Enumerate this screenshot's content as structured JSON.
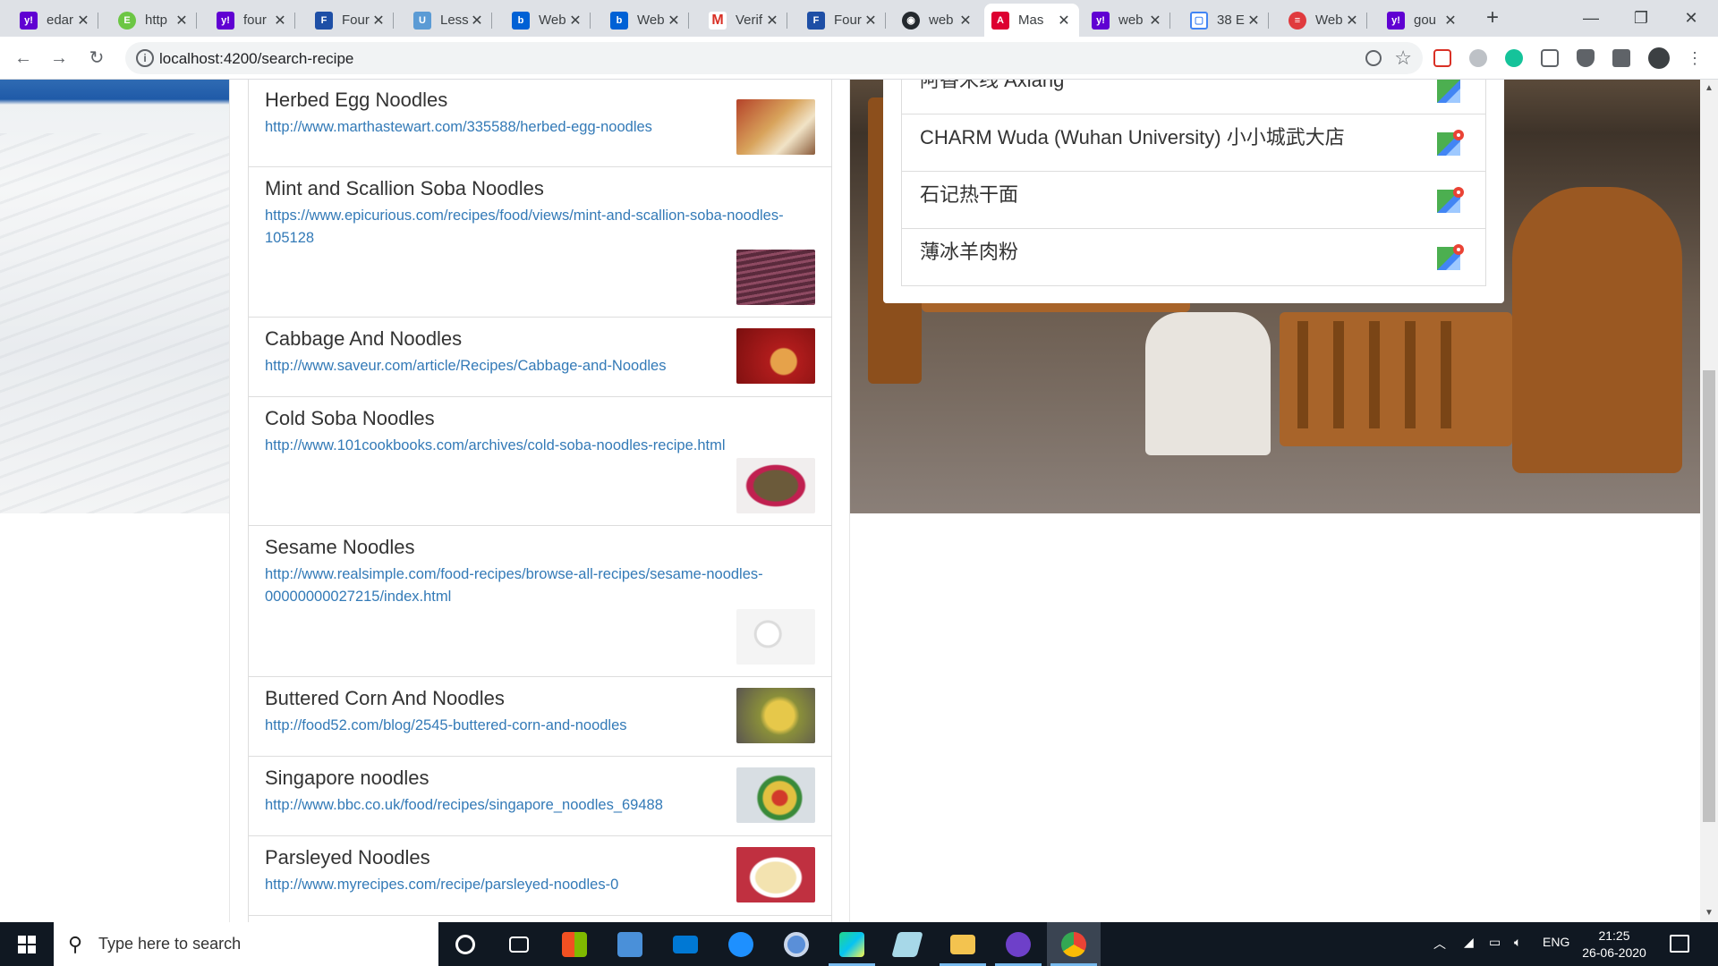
{
  "browser": {
    "tabs": [
      {
        "label": "edar",
        "favicon": "yahoo-icon",
        "color": "#6001d2"
      },
      {
        "label": "http",
        "favicon": "evernote-icon",
        "color": "#6cc644"
      },
      {
        "label": "four",
        "favicon": "yahoo-icon",
        "color": "#6001d2"
      },
      {
        "label": "Four",
        "favicon": "f-icon",
        "color": "#1e4fa6"
      },
      {
        "label": "Less",
        "favicon": "unc-icon",
        "color": "#5b9bd5"
      },
      {
        "label": "Web",
        "favicon": "box-icon",
        "color": "#0061d5"
      },
      {
        "label": "Web",
        "favicon": "box-icon",
        "color": "#0061d5"
      },
      {
        "label": "Verif",
        "favicon": "gmail-icon",
        "color": "#d93025"
      },
      {
        "label": "Four",
        "favicon": "f-icon",
        "color": "#1e4fa6"
      },
      {
        "label": "web",
        "favicon": "github-icon",
        "color": "#24292e"
      },
      {
        "label": "Mas",
        "favicon": "angular-icon",
        "color": "#dd0031"
      },
      {
        "label": "web",
        "favicon": "yahoo-icon",
        "color": "#6001d2"
      },
      {
        "label": "38 E",
        "favicon": "doc-icon",
        "color": "#4285f4"
      },
      {
        "label": "Web",
        "favicon": "stack-icon",
        "color": "#e03a3e"
      },
      {
        "label": "gou",
        "favicon": "yahoo-icon",
        "color": "#6001d2"
      }
    ],
    "tab_close": "✕",
    "new_tab": "+",
    "url": "localhost:4200/search-recipe"
  },
  "recipes": [
    {
      "title": "Herbed Egg Noodles",
      "url": "http://www.marthastewart.com/335588/herbed-egg-noodles"
    },
    {
      "title": "Mint and Scallion Soba Noodles",
      "url": "https://www.epicurious.com/recipes/food/views/mint-and-scallion-soba-noodles-105128"
    },
    {
      "title": "Cabbage And Noodles",
      "url": "http://www.saveur.com/article/Recipes/Cabbage-and-Noodles"
    },
    {
      "title": "Cold Soba Noodles",
      "url": "http://www.101cookbooks.com/archives/cold-soba-noodles-recipe.html"
    },
    {
      "title": "Sesame Noodles",
      "url": "http://www.realsimple.com/food-recipes/browse-all-recipes/sesame-noodles-00000000027215/index.html"
    },
    {
      "title": "Buttered Corn And Noodles",
      "url": "http://food52.com/blog/2545-buttered-corn-and-noodles"
    },
    {
      "title": "Singapore noodles",
      "url": "http://www.bbc.co.uk/food/recipes/singapore_noodles_69488"
    },
    {
      "title": "Parsleyed Noodles",
      "url": "http://www.myrecipes.com/recipe/parsleyed-noodles-0"
    }
  ],
  "restaurants": [
    {
      "name": "阿香米线 Axiang"
    },
    {
      "name": "CHARM Wuda (Wuhan University) 小小城武大店"
    },
    {
      "name": "石记热干面"
    },
    {
      "name": "薄冰羊肉粉"
    }
  ],
  "taskbar": {
    "search_placeholder": "Type here to search",
    "language": "ENG",
    "time": "21:25",
    "date": "26-06-2020"
  }
}
